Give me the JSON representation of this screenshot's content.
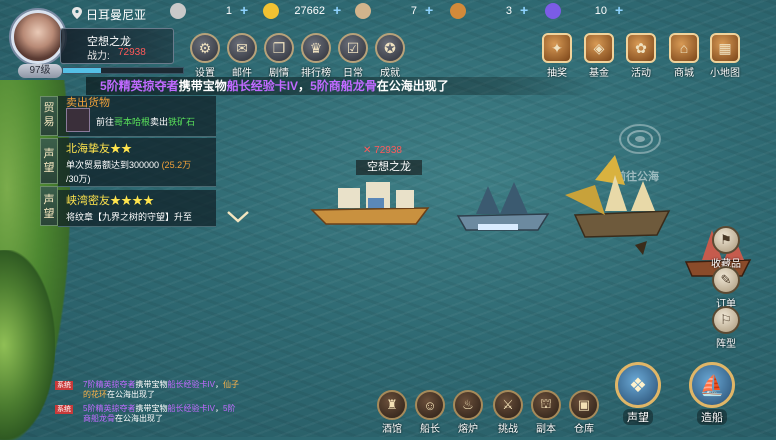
{
  "player": {
    "server": "日耳曼尼亚",
    "name": "空想之龙",
    "power_label": "战力:",
    "power_value": "72938",
    "level": "97级",
    "exp_fraction": 0.32
  },
  "resources": [
    {
      "icon": "silver-coin-icon",
      "value": "1",
      "color": "#c9c9c9"
    },
    {
      "icon": "gold-coin-icon",
      "value": "27662",
      "color": "#f2c232"
    },
    {
      "icon": "scroll-icon",
      "value": "7",
      "color": "#d2b48c"
    },
    {
      "icon": "card-icon",
      "value": "3",
      "color": "#d38a3a"
    },
    {
      "icon": "gem-icon",
      "value": "10",
      "color": "#7b5ce6"
    }
  ],
  "left_menu": [
    {
      "label": "设置",
      "icon": "gear-icon",
      "glyph": "⚙"
    },
    {
      "label": "邮件",
      "icon": "mail-icon",
      "glyph": "✉"
    },
    {
      "label": "剧情",
      "icon": "book-icon",
      "glyph": "❐"
    },
    {
      "label": "排行榜",
      "icon": "ranking-icon",
      "glyph": "♛"
    },
    {
      "label": "日常",
      "icon": "daily-icon",
      "glyph": "☑"
    },
    {
      "label": "成就",
      "icon": "achievement-icon",
      "glyph": "✪"
    }
  ],
  "right_menu": [
    {
      "label": "抽奖",
      "icon": "treasure-chest-icon",
      "glyph": "✦"
    },
    {
      "label": "基金",
      "icon": "fund-icon",
      "glyph": "◈"
    },
    {
      "label": "活动",
      "icon": "gift-icon",
      "glyph": "✿"
    },
    {
      "label": "商城",
      "icon": "shop-icon",
      "glyph": "⌂"
    },
    {
      "label": "小地图",
      "icon": "map-icon",
      "glyph": "▦"
    }
  ],
  "marquee": {
    "part1": "5阶精英掠夺者",
    "part2": "携带宝物",
    "part3": "船长经验卡IV",
    "part4": "，",
    "part5": "5阶商船龙骨",
    "part6": "在公海出现了"
  },
  "quest_tabs": [
    "贸易",
    "声望",
    "声望"
  ],
  "quests": [
    {
      "title": "卖出货物",
      "line1_a": "前往",
      "line1_b": "哥本哈根",
      "line1_c": "卖出",
      "line1_d": "铁矿石"
    },
    {
      "title": "北海挚友★★",
      "line1": "单次贸易额达到300000",
      "progress": "(25.2万",
      "line2": "/30万)"
    },
    {
      "title": "峡湾密友★★★★",
      "line1": "将纹章【九界之树的守望】升至"
    }
  ],
  "map": {
    "ship_name": "空想之龙",
    "ship_power": "72938",
    "sail_to": "前往公海"
  },
  "side_right": [
    {
      "label": "收藏品",
      "icon": "collection-icon",
      "glyph": "⚑"
    },
    {
      "label": "订单",
      "icon": "order-icon",
      "glyph": "✎"
    },
    {
      "label": "阵型",
      "icon": "formation-icon",
      "glyph": "⚐"
    }
  ],
  "chat": [
    {
      "tag": "系统",
      "a": "7阶精英掠夺者",
      "b": "携带宝物",
      "c": "船长经验卡",
      "d": "IV",
      "e": "，",
      "f": "仙子的花环",
      "g": "在公海出现了"
    },
    {
      "tag": "系统",
      "a": "5阶精英掠夺者",
      "b": "携带宝物",
      "c": "船长经验卡",
      "d": "IV",
      "e": "，",
      "f": "5阶商船龙骨",
      "g": "在公海出现了"
    }
  ],
  "bottom_menu": [
    {
      "label": "酒馆",
      "icon": "tavern-icon",
      "glyph": "♜"
    },
    {
      "label": "船长",
      "icon": "captain-icon",
      "glyph": "☺"
    },
    {
      "label": "熔炉",
      "icon": "furnace-icon",
      "glyph": "♨"
    },
    {
      "label": "挑战",
      "icon": "swords-icon",
      "glyph": "⚔"
    },
    {
      "label": "副本",
      "icon": "dungeon-icon",
      "glyph": "⛫"
    },
    {
      "label": "仓库",
      "icon": "warehouse-icon",
      "glyph": "▣"
    }
  ],
  "big_buttons": [
    {
      "label": "声望",
      "icon": "eagle-emblem-icon",
      "glyph": "❖"
    },
    {
      "label": "造船",
      "icon": "shipbuild-icon",
      "glyph": "⛵"
    }
  ]
}
